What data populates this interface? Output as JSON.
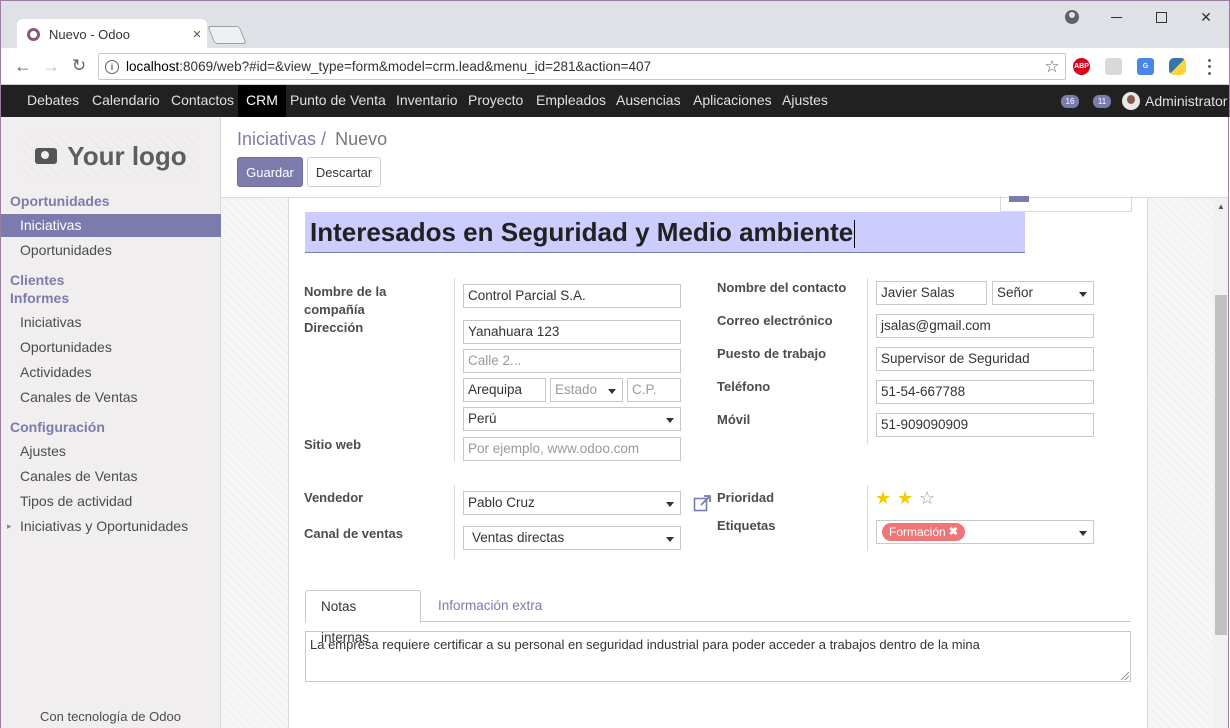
{
  "browser": {
    "tab_title": "Nuevo - Odoo",
    "tab_close": "×",
    "url_host": "localhost",
    "url_rest": ":8069/web?#id=&view_type=form&model=crm.lead&menu_id=281&action=407",
    "ext_abp": "ABP"
  },
  "navbar": {
    "items": [
      "Debates",
      "Calendario",
      "Contactos",
      "CRM",
      "Punto de Venta",
      "Inventario",
      "Proyecto",
      "Empleados",
      "Ausencias",
      "Aplicaciones",
      "Ajustes"
    ],
    "active_item": "CRM",
    "activity_count": "16",
    "message_count": "11",
    "user_name": "Administrator"
  },
  "sidebar": {
    "logo_text": "Your logo",
    "sections": [
      {
        "title": "Oportunidades",
        "items": [
          "Iniciativas",
          "Oportunidades"
        ]
      },
      {
        "title": "Clientes",
        "items": []
      },
      {
        "title": "Informes",
        "items": [
          "Iniciativas",
          "Oportunidades",
          "Actividades",
          "Canales de Ventas"
        ]
      },
      {
        "title": "Configuración",
        "items": [
          "Ajustes",
          "Canales de Ventas",
          "Tipos de actividad",
          "Iniciativas y Oportunidades"
        ]
      }
    ],
    "active_item": "Iniciativas",
    "expand_caret": "▸",
    "powered_by": "Con tecnología de Odoo"
  },
  "control_panel": {
    "breadcrumb_parent": "Iniciativas",
    "breadcrumb_sep": "/",
    "breadcrumb_current": "Nuevo",
    "save_label": "Guardar",
    "discard_label": "Descartar"
  },
  "form": {
    "name": "Interesados en Seguridad y Medio ambiente",
    "labels": {
      "company": "Nombre de la compañía",
      "address": "Dirección",
      "website": "Sitio web",
      "contact_name": "Nombre del contacto",
      "email": "Correo electrónico",
      "job": "Puesto de trabajo",
      "phone": "Teléfono",
      "mobile": "Móvil",
      "salesperson": "Vendedor",
      "channel": "Canal de ventas",
      "priority": "Prioridad",
      "tags": "Etiquetas"
    },
    "values": {
      "company": "Control Parcial S.A.",
      "street": "Yanahuara 123",
      "street2_placeholder": "Calle 2...",
      "city": "Arequipa",
      "state_placeholder": "Estado",
      "zip_placeholder": "C.P.",
      "country": "Perú",
      "website_placeholder": "Por ejemplo, www.odoo.com",
      "contact_name": "Javier Salas",
      "title": "Señor",
      "email": "jsalas@gmail.com",
      "job": "Supervisor de Seguridad",
      "phone": "51-54-667788",
      "mobile": "51-909090909",
      "salesperson": "Pablo Cruz",
      "channel": "Ventas directas",
      "priority_stars": 2,
      "priority_max": 3,
      "tag": "Formación",
      "tag_remove": "✖"
    },
    "tabs": [
      "Notas internas",
      "Información extra"
    ],
    "active_tab": "Notas internas",
    "notes": "La empresa requiere certificar a su personal en seguridad industrial para poder acceder a trabajos dentro de la mina"
  },
  "colors": {
    "brand": "#7c7bad",
    "tag": "#ef7678",
    "star": "#f3cc00"
  }
}
